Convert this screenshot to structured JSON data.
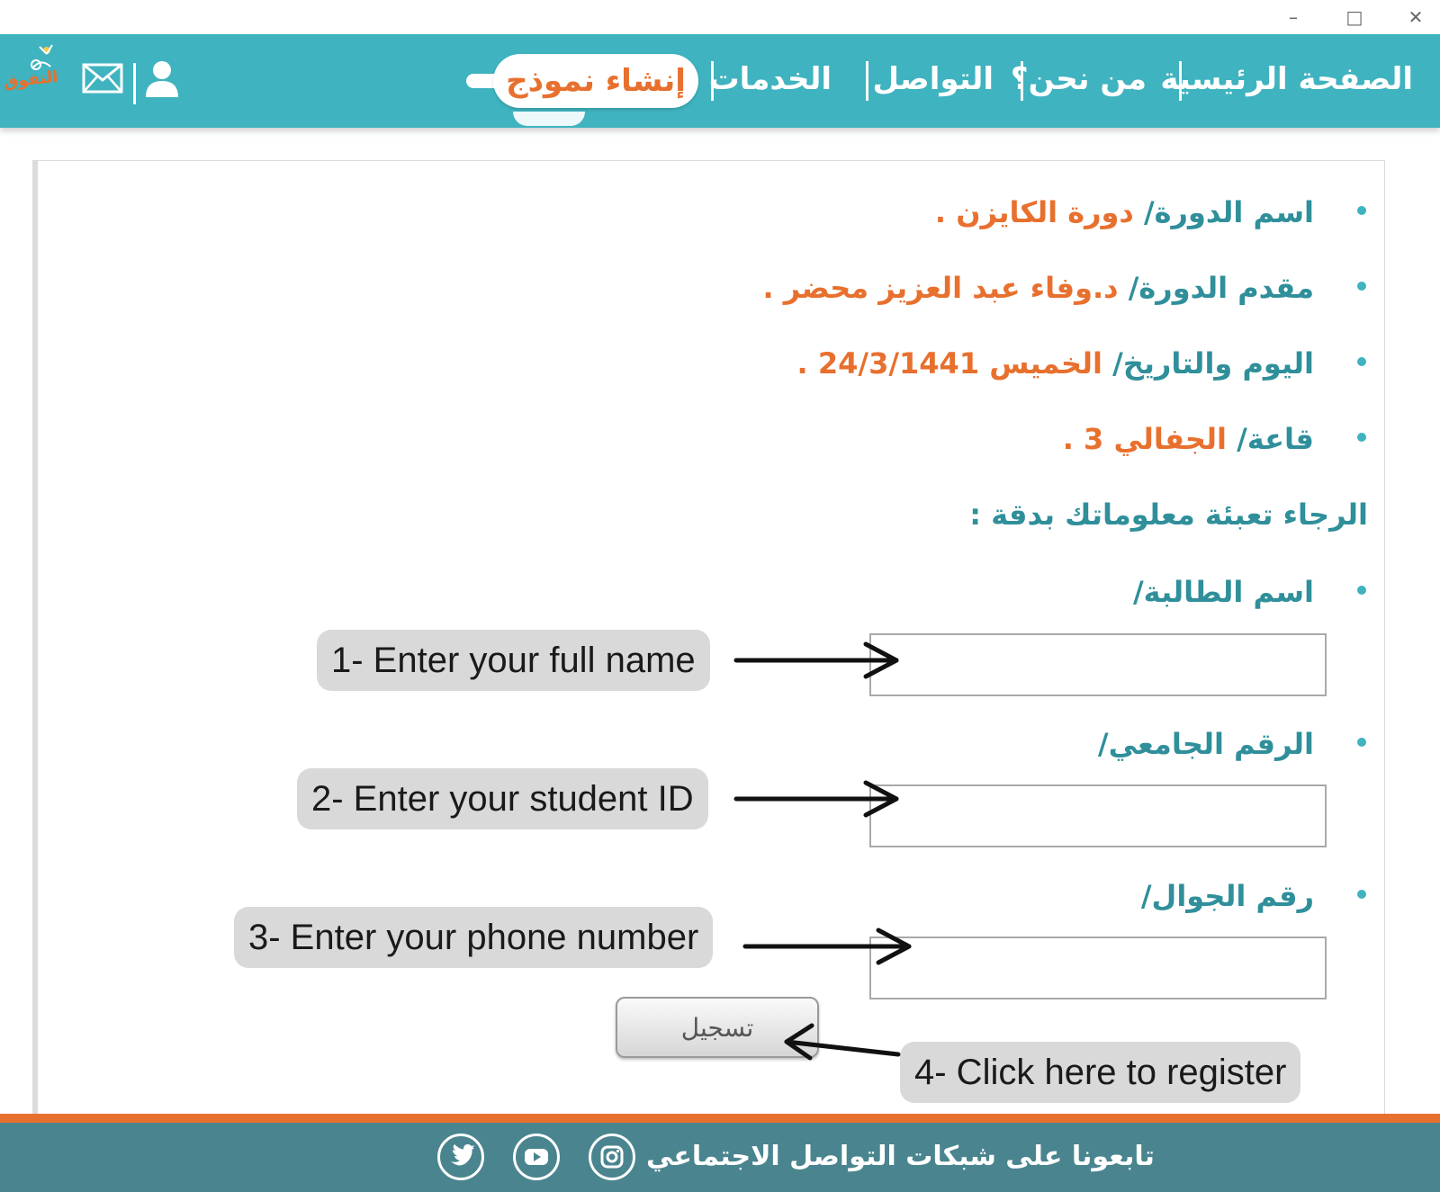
{
  "window": {
    "minimize_glyph": "–",
    "maximize_glyph": "□",
    "close_glyph": "✕"
  },
  "nav": {
    "items": [
      "الصفحة الرئيسية",
      "من نحن؟",
      "التواصل",
      "الخدمات"
    ],
    "create_form_label": "إنشاء نموذج",
    "logo_text": "التفوق",
    "icons": [
      "mail-icon",
      "user-icon"
    ]
  },
  "course": {
    "name_label": "اسم الدورة/",
    "name_value": "دورة الكايزن .",
    "presenter_label": "مقدم الدورة/",
    "presenter_value": "د.وفاء عبد العزيز محضر .",
    "date_label": "اليوم والتاريخ/",
    "date_value": "الخميس 24/3/1441 .",
    "hall_label": "قاعة/",
    "hall_value": "الجفالي 3 ."
  },
  "form": {
    "instruction": "الرجاء تعبئة معلوماتك بدقة :",
    "student_name_label": "اسم الطالبة/",
    "student_id_label": "الرقم الجامعي/",
    "phone_label": "رقم الجوال/",
    "student_name_value": "",
    "student_id_value": "",
    "phone_value": "",
    "register_button": "تسجيل"
  },
  "callouts": {
    "step1": "1- Enter your full name",
    "step2": "2- Enter your student ID",
    "step3": "3- Enter your phone number",
    "step4": "4- Click here to register"
  },
  "footer": {
    "text": "تابعونا على شبكات التواصل الاجتماعي",
    "social_icons": [
      "instagram-icon",
      "youtube-icon",
      "twitter-icon"
    ]
  },
  "colors": {
    "header_teal": "#3fb3bf",
    "accent_orange": "#e8702e",
    "footer_teal": "#4a858f",
    "label_teal": "#2f8f9a"
  }
}
